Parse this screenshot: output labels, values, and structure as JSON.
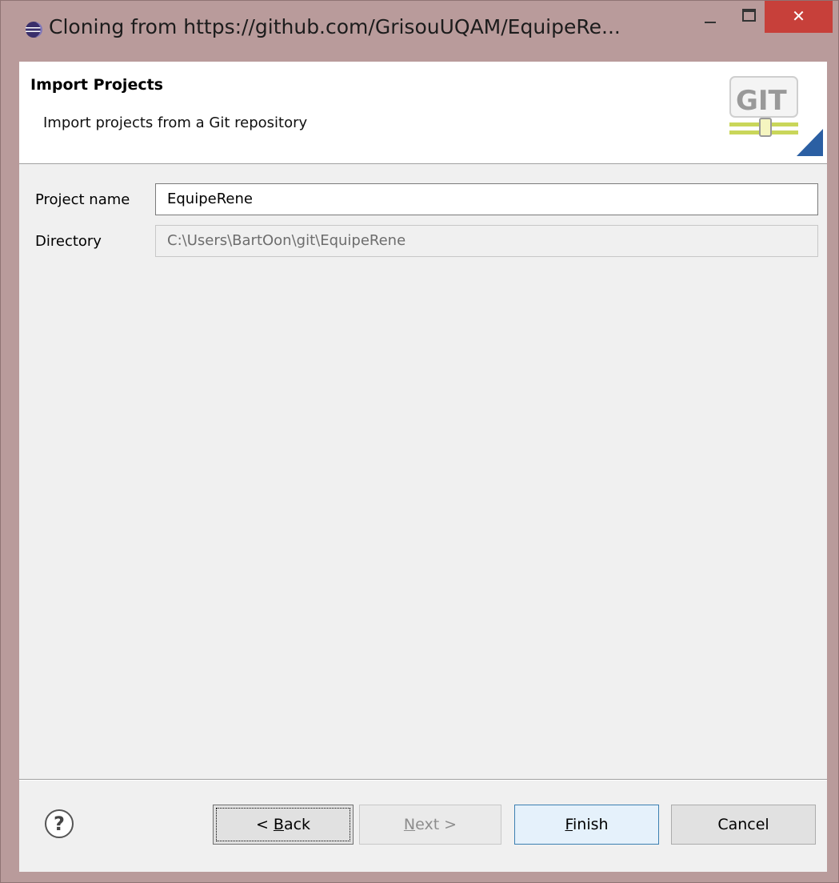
{
  "window": {
    "title": "Cloning from https://github.com/GrisouUQAM/EquipeRe...",
    "close_symbol": "✕"
  },
  "header": {
    "title": "Import Projects",
    "description": "Import projects from a Git repository",
    "logo_text": "GIT"
  },
  "form": {
    "project_label": "Project name",
    "project_value": "EquipeRene",
    "directory_label": "Directory",
    "directory_value": "C:\\Users\\BartOon\\git\\EquipeRene"
  },
  "buttons": {
    "help_symbol": "?",
    "back_prefix": "< ",
    "back_mnemonic": "B",
    "back_rest": "ack",
    "next_mnemonic": "N",
    "next_rest": "ext >",
    "finish_mnemonic": "F",
    "finish_rest": "inish",
    "cancel": "Cancel"
  }
}
